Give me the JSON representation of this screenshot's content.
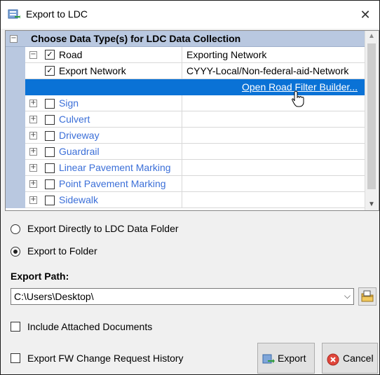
{
  "window": {
    "title": "Export to LDC"
  },
  "grid": {
    "header": "Choose Data Type(s) for LDC Data Collection",
    "road": {
      "label": "Road",
      "value": "Exporting Network"
    },
    "export_network": {
      "label": "Export Network",
      "value": "CYYY-Local/Non-federal-aid-Network"
    },
    "filter_link": "Open Road Filter Builder...",
    "items": [
      {
        "label": "Sign"
      },
      {
        "label": "Culvert"
      },
      {
        "label": "Driveway"
      },
      {
        "label": "Guardrail"
      },
      {
        "label": "Linear Pavement Marking"
      },
      {
        "label": "Point Pavement Marking"
      },
      {
        "label": "Sidewalk"
      }
    ]
  },
  "options": {
    "export_ldc": "Export Directly to LDC Data Folder",
    "export_folder": "Export to Folder"
  },
  "export_path": {
    "label": "Export Path:",
    "value": "C:\\Users\\Desktop\\"
  },
  "checks": {
    "include_docs": "Include Attached Documents",
    "export_history": "Export FW Change Request History"
  },
  "buttons": {
    "export": "Export",
    "cancel": "Cancel"
  }
}
